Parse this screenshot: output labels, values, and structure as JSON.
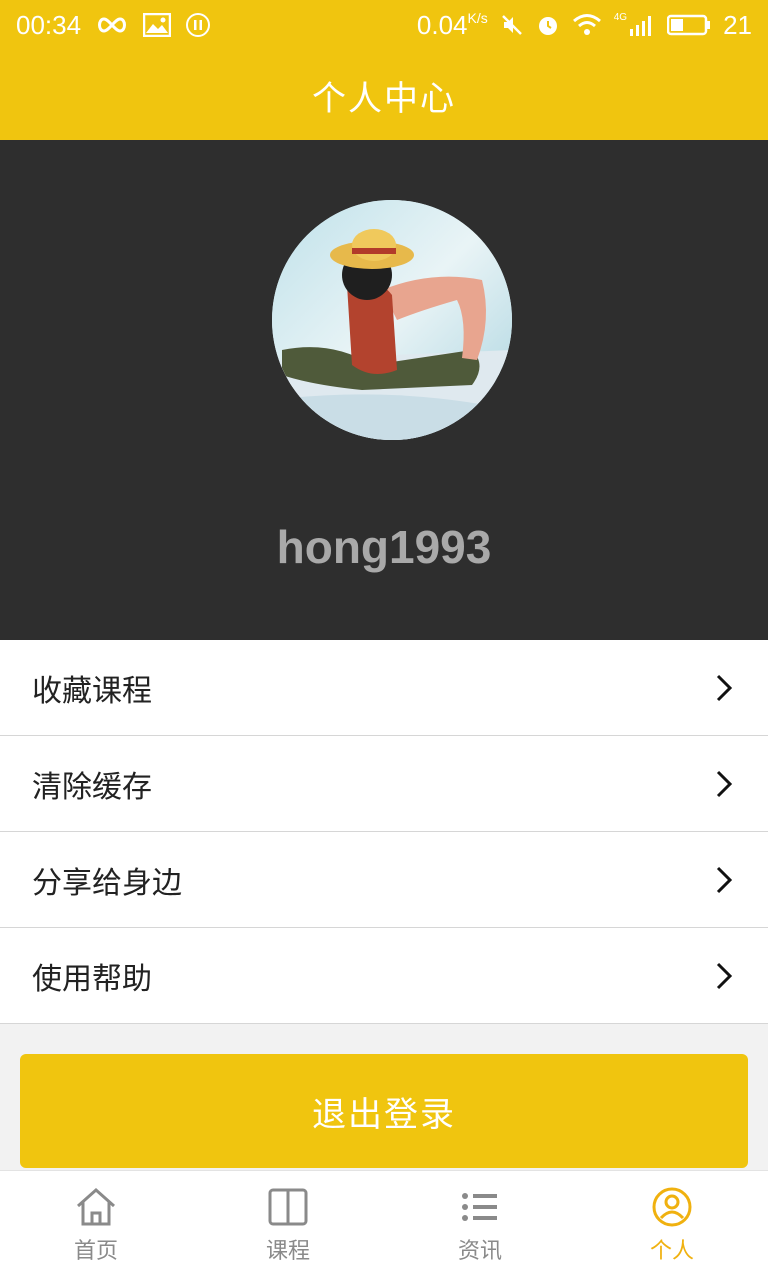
{
  "status_bar": {
    "time": "00:34",
    "net_speed": "0.04",
    "net_unit": "K/s",
    "network": "4G",
    "battery": "21",
    "icons": [
      "infinity-icon",
      "image-icon",
      "pause-icon",
      "mute-icon",
      "alarm-icon",
      "wifi-icon",
      "signal-icon",
      "battery-icon"
    ]
  },
  "header": {
    "title": "个人中心"
  },
  "profile": {
    "username": "hong1993",
    "avatar_icon": "avatar-image"
  },
  "menu": {
    "items": [
      {
        "label": "收藏课程"
      },
      {
        "label": "清除缓存"
      },
      {
        "label": "分享给身边"
      },
      {
        "label": "使用帮助"
      }
    ]
  },
  "logout": {
    "label": "退出登录"
  },
  "tabbar": {
    "tabs": [
      {
        "label": "首页",
        "icon": "home-icon"
      },
      {
        "label": "课程",
        "icon": "book-icon"
      },
      {
        "label": "资讯",
        "icon": "list-icon"
      },
      {
        "label": "个人",
        "icon": "user-icon"
      }
    ],
    "active": "个人"
  },
  "colors": {
    "accent": "#f0c50f",
    "dark": "#2e2e2e",
    "active_tab": "#f0b10f"
  }
}
